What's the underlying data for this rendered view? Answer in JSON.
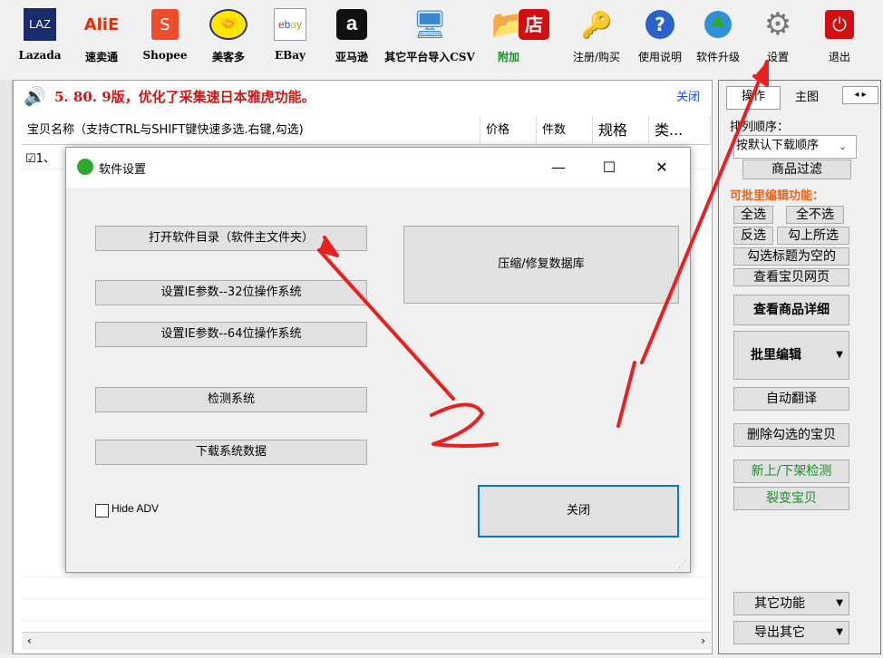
{
  "toolbar": {
    "items": [
      {
        "label": "Lazada",
        "icon": "lazada-icon",
        "glyph": "LAZ",
        "color": "#1a2b6b"
      },
      {
        "label": "速卖通",
        "icon": "aliexpress-icon",
        "glyph": "AliE",
        "color": "#e62e04"
      },
      {
        "label": "Shopee",
        "icon": "shopee-bag-icon",
        "glyph": "S",
        "color": "#ee4d2d"
      },
      {
        "label": "美客多",
        "icon": "handshake-icon",
        "glyph": "🤝",
        "color": "#ffe600"
      },
      {
        "label": "EBay",
        "icon": "ebay-icon",
        "glyph": "ebay",
        "color": "#fff"
      },
      {
        "label": "亚马逊",
        "icon": "amazon-icon",
        "glyph": "a",
        "color": "#111"
      },
      {
        "label": "其它平台导入CSV",
        "icon": "monitor-icon",
        "glyph": "🖥",
        "color": "#3a86d0"
      },
      {
        "label": "附加",
        "icon": "folder-icon",
        "glyph": "📂",
        "color": "#e8b828"
      },
      {
        "label": "注册/购买",
        "icon": "shop-icon",
        "glyph": "店",
        "color": "#d01010"
      },
      {
        "label": "使用说明",
        "icon": "keys-icon",
        "glyph": "🔑",
        "color": "#c9a227"
      },
      {
        "label": "软件升级",
        "icon": "help-icon",
        "glyph": "?",
        "color": "#2a63c8"
      },
      {
        "label": "设置",
        "icon": "gear-icon",
        "glyph": "⚙",
        "color": "#888"
      },
      {
        "label": "退出",
        "icon": "power-icon",
        "glyph": "⏻",
        "color": "#d01010"
      }
    ],
    "extra_label": "附加",
    "extra_color": "#1a8a2a"
  },
  "notice": {
    "text": "5. 80. 9版，优化了采集速日本雅虎功能。",
    "close": "关闭"
  },
  "list": {
    "columns": [
      "宝贝名称（支持CTRL与SHIFT键快速多选.右键,勾选)",
      "价格",
      "件数",
      "规格",
      "类..."
    ],
    "first_row": "☑1、"
  },
  "right_panel": {
    "tabs": [
      "操作",
      "主图"
    ],
    "sort_label": "排列顺序：",
    "sort_value": "按默认下载顺序",
    "filter_btn": "商品过滤",
    "batch_title": "可批里编辑功能：",
    "select_all": "全选",
    "select_none": "全不选",
    "invert": "反选",
    "check_selected": "勾上所选",
    "check_empty_title": "勾选标题为空的",
    "view_page": "查看宝贝网页",
    "view_detail": "查看商品详细",
    "batch_edit": "批里编辑",
    "auto_translate": "自动翻译",
    "delete_checked": "删除勾选的宝贝",
    "onoff_check": "新上/下架检测",
    "split": "裂变宝贝",
    "other_func": "其它功能",
    "export_other": "导出其它"
  },
  "dialog": {
    "title": "软件设置",
    "buttons": {
      "open_dir": "打开软件目录（软件主文件夹）",
      "ie32": "设置IE参数--32位操作系统",
      "ie64": "设置IE参数--64位操作系统",
      "detect": "检测系统",
      "download_data": "下载系统数据",
      "repair_db": "压缩/修复数据库",
      "close": "关闭"
    },
    "hide_adv": "Hide ADV",
    "hide_adv_checked": false
  },
  "annotations": {
    "one": "1",
    "two": "2",
    "color": "#e82020"
  }
}
